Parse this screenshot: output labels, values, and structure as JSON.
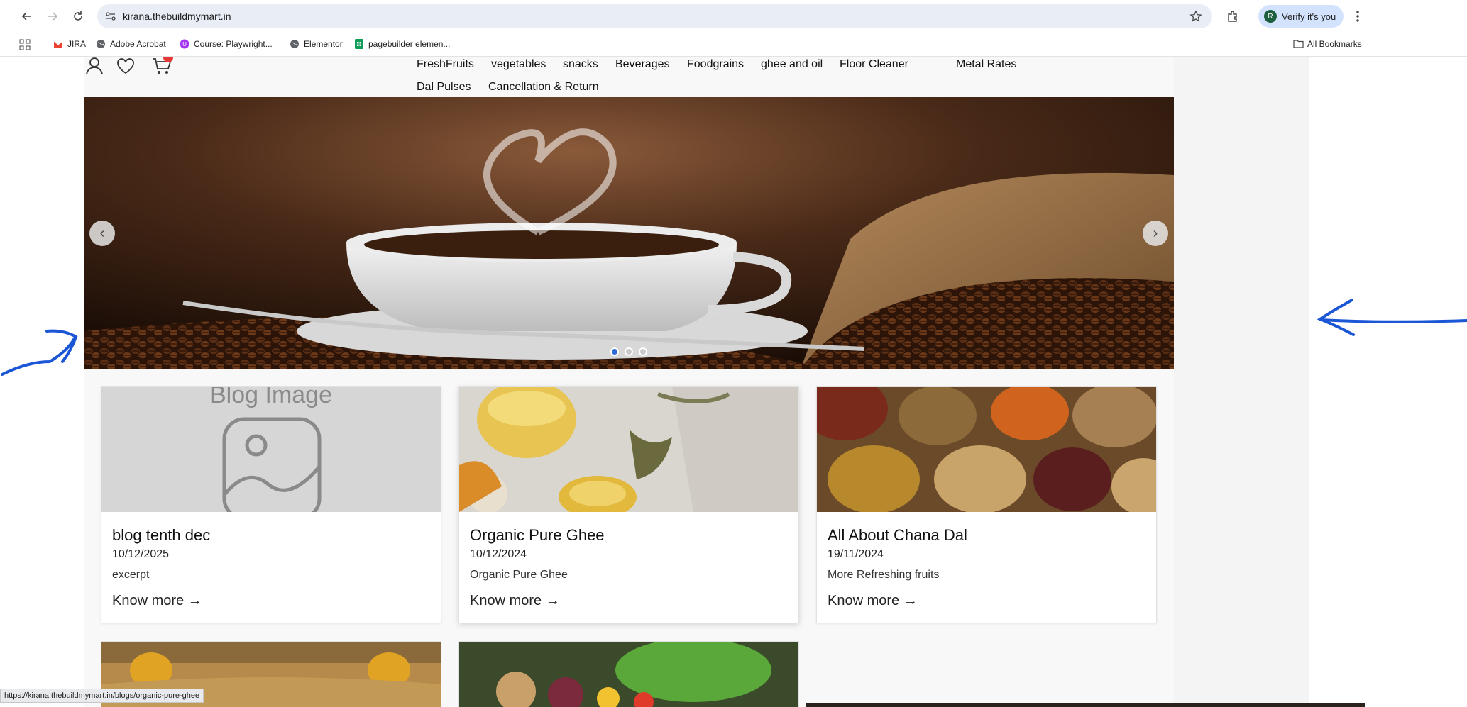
{
  "browser": {
    "url": "kirana.thebuildmymart.in",
    "verify_label": "Verify it's you",
    "avatar_initial": "R",
    "status_url": "https://kirana.thebuildmymart.in/blogs/organic-pure-ghee"
  },
  "bookmarks": {
    "items": [
      {
        "label": "JIRA",
        "icon": "gmail-icon"
      },
      {
        "label": "Adobe Acrobat",
        "icon": "globe-icon"
      },
      {
        "label": "Course: Playwright...",
        "icon": "course-icon"
      },
      {
        "label": "Elementor",
        "icon": "globe-icon"
      },
      {
        "label": "pagebuilder elemen...",
        "icon": "sheets-icon"
      }
    ],
    "all_bookmarks": "All Bookmarks"
  },
  "nav": {
    "items": [
      "FreshFruits",
      "vegetables",
      "snacks",
      "Beverages",
      "Foodgrains",
      "ghee and oil",
      "Floor Cleaner",
      "Metal Rates",
      "Dal Pulses",
      "Cancellation & Return"
    ]
  },
  "hero": {
    "slides": 3,
    "active_slide": 1,
    "prev_label": "‹",
    "next_label": "›"
  },
  "blogs": [
    {
      "title": "blog tenth dec",
      "date": "10/12/2025",
      "excerpt": "excerpt",
      "more": "Know more →",
      "image": "placeholder",
      "placeholder_text": "Blog Image"
    },
    {
      "title": "Organic Pure Ghee",
      "date": "10/12/2024",
      "excerpt": "Organic Pure Ghee",
      "more": "Know more →",
      "image": "ghee"
    },
    {
      "title": "All About Chana Dal",
      "date": "19/11/2024",
      "excerpt": "More Refreshing fruits",
      "more": "Know more →",
      "image": "grains"
    }
  ],
  "colors": {
    "accent": "#2f6bd8",
    "annotation": "#1a56d6",
    "badge": "#e53935"
  }
}
